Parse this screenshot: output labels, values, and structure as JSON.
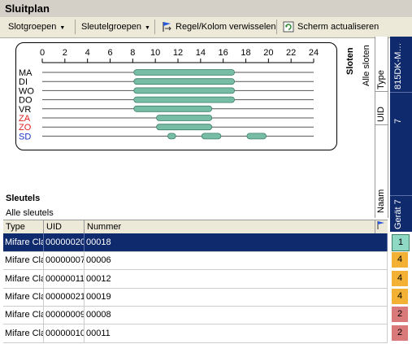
{
  "window": {
    "title": "Sluitplan"
  },
  "toolbar": {
    "slotgroepen": "Slotgroepen",
    "sleutelgroepen": "Sleutelgroepen",
    "swap": "Regel/Kolom verwisselen",
    "refresh": "Scherm actualiseren"
  },
  "schedule": {
    "ticks": [
      "0",
      "2",
      "4",
      "6",
      "8",
      "10",
      "12",
      "14",
      "16",
      "18",
      "20",
      "22",
      "24"
    ],
    "days": [
      {
        "label": "MA",
        "color": "#000000",
        "bars": [
          [
            8.1,
            17.0
          ]
        ]
      },
      {
        "label": "DI",
        "color": "#000000",
        "bars": [
          [
            8.1,
            17.0
          ]
        ]
      },
      {
        "label": "WO",
        "color": "#000000",
        "bars": [
          [
            8.1,
            17.0
          ]
        ]
      },
      {
        "label": "DO",
        "color": "#000000",
        "bars": [
          [
            8.1,
            17.0
          ]
        ]
      },
      {
        "label": "VR",
        "color": "#000000",
        "bars": [
          [
            8.1,
            15.0
          ]
        ]
      },
      {
        "label": "ZA",
        "color": "#e02020",
        "bars": [
          [
            10.1,
            15.0
          ]
        ]
      },
      {
        "label": "ZO",
        "color": "#e02020",
        "bars": [
          [
            10.1,
            15.0
          ]
        ]
      },
      {
        "label": "SD",
        "color": "#1a33c8",
        "bars": [
          [
            11.1,
            11.8
          ],
          [
            14.1,
            15.8
          ],
          [
            18.1,
            19.8
          ]
        ]
      }
    ],
    "bar_color": "#77bca4"
  },
  "locks": {
    "title": "Sloten",
    "subtitle": "Alle sloten",
    "col_type": "Type",
    "col_uid": "UID",
    "col_naam": "Naam",
    "device_name": "815DK-M…",
    "device_uid": "7",
    "device_label": "Gerät 7"
  },
  "keys": {
    "title": "Sleutels",
    "subtitle": "Alle sleutels",
    "columns": [
      "Type",
      "UID",
      "Nummer"
    ],
    "rows": [
      {
        "type": "Mifare Cla",
        "uid": "00000020",
        "nummer": "00018",
        "count": "1",
        "count_color": "#8fd8c3",
        "selected": true
      },
      {
        "type": "Mifare Cla",
        "uid": "00000007",
        "nummer": "00006",
        "count": "4",
        "count_color": "#f2b134",
        "selected": false
      },
      {
        "type": "Mifare Cla",
        "uid": "00000011",
        "nummer": "00012",
        "count": "4",
        "count_color": "#f2b134",
        "selected": false
      },
      {
        "type": "Mifare Cla",
        "uid": "00000021",
        "nummer": "00019",
        "count": "4",
        "count_color": "#f2b134",
        "selected": false
      },
      {
        "type": "Mifare Cla",
        "uid": "00000009",
        "nummer": "00008",
        "count": "2",
        "count_color": "#d9797a",
        "selected": false
      },
      {
        "type": "Mifare Cla",
        "uid": "00000010",
        "nummer": "00011",
        "count": "2",
        "count_color": "#d9797a",
        "selected": false
      }
    ]
  }
}
